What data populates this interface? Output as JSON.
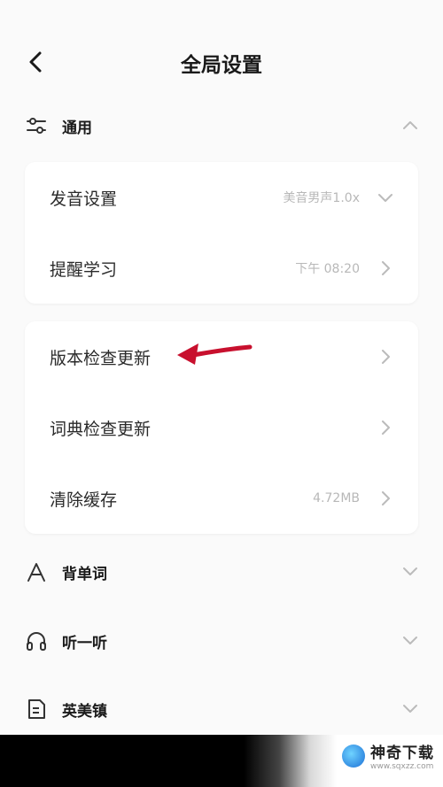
{
  "header": {
    "title": "全局设置"
  },
  "sections": {
    "general": {
      "label": "通用"
    },
    "vocab": {
      "label": "背单词"
    },
    "listen": {
      "label": "听一听"
    },
    "town": {
      "label": "英美镇"
    }
  },
  "general_card1": {
    "pronunciation": {
      "label": "发音设置",
      "value": "美音男声1.0x"
    },
    "reminder": {
      "label": "提醒学习",
      "value": "下午 08:20"
    }
  },
  "general_card2": {
    "version_update": {
      "label": "版本检查更新"
    },
    "dict_update": {
      "label": "词典检查更新"
    },
    "clear_cache": {
      "label": "清除缓存",
      "value": "4.72MB"
    }
  },
  "watermark": {
    "title": "神奇下载",
    "url": "www.sqxzz.com"
  },
  "colors": {
    "background": "#fafafa",
    "card": "#ffffff",
    "annotation_arrow": "#c8102e"
  }
}
